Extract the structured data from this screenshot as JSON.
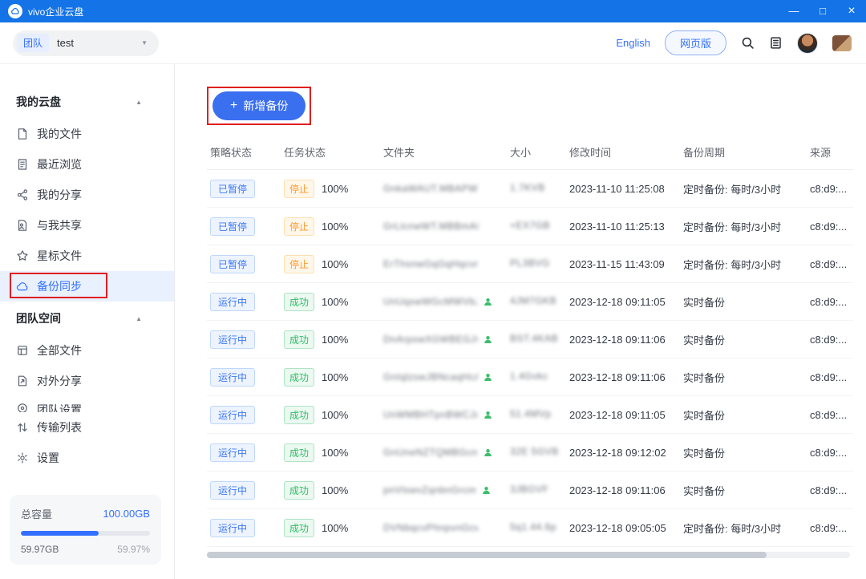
{
  "window": {
    "title": "vivo企业云盘",
    "controls": {
      "minimize": "—",
      "maximize": "□",
      "close": "×"
    }
  },
  "toolbar": {
    "team_badge": "团队",
    "team_name": "test",
    "caret": "▼",
    "english_link": "English",
    "web_version": "网页版"
  },
  "sidebar": {
    "collapse_glyph": "▲",
    "groups": [
      {
        "id": "my-cloud",
        "label": "我的云盘",
        "items": [
          {
            "id": "my-files",
            "icon": "file",
            "label": "我的文件"
          },
          {
            "id": "recent",
            "icon": "recent",
            "label": "最近浏览"
          },
          {
            "id": "my-share",
            "icon": "share",
            "label": "我的分享"
          },
          {
            "id": "shared-with-me",
            "icon": "shared",
            "label": "与我共享"
          },
          {
            "id": "starred",
            "icon": "star",
            "label": "星标文件"
          },
          {
            "id": "backup-sync",
            "icon": "cloud",
            "label": "备份同步",
            "selected": true,
            "annotated": true
          }
        ]
      },
      {
        "id": "team-space",
        "label": "团队空间",
        "items": [
          {
            "id": "all-files",
            "icon": "files",
            "label": "全部文件"
          },
          {
            "id": "external-share",
            "icon": "external",
            "label": "对外分享"
          },
          {
            "id": "team-settings",
            "icon": "circle",
            "label": "团队设置",
            "clipped": true
          }
        ]
      }
    ],
    "tools": [
      {
        "id": "transfer-list",
        "icon": "transfer",
        "label": "传输列表"
      },
      {
        "id": "settings",
        "icon": "gear",
        "label": "设置"
      }
    ],
    "storage": {
      "total_label": "总容量",
      "total_value": "100.00GB",
      "used_value": "59.97GB",
      "used_percent": "59.97%",
      "bar_style": "width:59.97%"
    }
  },
  "main": {
    "add_button": {
      "icon": "+",
      "label": "新增备份"
    },
    "table": {
      "columns": [
        "策略状态",
        "任务状态",
        "文件夹",
        "大小",
        "修改时间",
        "备份周期",
        "来源"
      ],
      "rows": [
        {
          "policy": "已暂停",
          "task": "停止",
          "task_style": "orange",
          "progress": "100%",
          "folder": "GnkaWAUT.MBAPWHL",
          "member": false,
          "size": "1.7KVB",
          "modified": "2023-11-10 11:25:08",
          "cycle": "定时备份: 每时/3小时",
          "source": "c8:d9:..."
        },
        {
          "policy": "已暂停",
          "task": "停止",
          "task_style": "orange",
          "progress": "100%",
          "folder": "GrLlcnwWT.MBBmABvM",
          "member": false,
          "size": "+EX7GB",
          "modified": "2023-11-10 11:25:13",
          "cycle": "定时备份: 每时/3小时",
          "source": "c8:d9:..."
        },
        {
          "policy": "已暂停",
          "task": "停止",
          "task_style": "orange",
          "progress": "100%",
          "folder": "ErThsnwGqGqHqcvna",
          "member": false,
          "size": "PL3BVG",
          "modified": "2023-11-15 11:43:09",
          "cycle": "定时备份: 每时/3小时",
          "source": "c8:d9:..."
        },
        {
          "policy": "运行中",
          "task": "成功",
          "task_style": "green",
          "progress": "100%",
          "folder": "UnUqswWGcMWVbJm",
          "member": true,
          "size": "4JM7GKB",
          "modified": "2023-12-18 09:11:05",
          "cycle": "实时备份",
          "source": "c8:d9:..."
        },
        {
          "policy": "运行中",
          "task": "成功",
          "task_style": "green",
          "progress": "100%",
          "folder": "DnArpswXGWBEGJvc",
          "member": true,
          "size": "BST.4KAB",
          "modified": "2023-12-18 09:11:06",
          "cycle": "实时备份",
          "source": "c8:d9:..."
        },
        {
          "policy": "运行中",
          "task": "成功",
          "task_style": "green",
          "progress": "100%",
          "folder": "GnIqlzswJBNcaqHcA",
          "member": true,
          "size": "1.4Gvkc",
          "modified": "2023-12-18 09:11:06",
          "cycle": "实时备份",
          "source": "c8:d9:..."
        },
        {
          "policy": "运行中",
          "task": "成功",
          "task_style": "green",
          "progress": "100%",
          "folder": "UnWMBHTpnBWCJcv",
          "member": true,
          "size": "51.4MVp",
          "modified": "2023-12-18 09:11:05",
          "cycle": "实时备份",
          "source": "c8:d9:..."
        },
        {
          "policy": "运行中",
          "task": "成功",
          "task_style": "green",
          "progress": "100%",
          "folder": "GnUneNZTQMBGcnw",
          "member": true,
          "size": "32E 5GVB",
          "modified": "2023-12-18 09:12:02",
          "cycle": "实时备份",
          "source": "c8:d9:..."
        },
        {
          "policy": "运行中",
          "task": "成功",
          "task_style": "green",
          "progress": "100%",
          "folder": "pnVlswvZqnbnGrcm",
          "member": true,
          "size": "3JBGVF",
          "modified": "2023-12-18 09:11:06",
          "cycle": "实时备份",
          "source": "c8:d9:..."
        },
        {
          "policy": "运行中",
          "task": "成功",
          "task_style": "green",
          "progress": "100%",
          "folder": "DVNbqcvPhnpvnGcw",
          "member": false,
          "size": "5q1.44.6p",
          "modified": "2023-12-18 09:05:05",
          "cycle": "定时备份: 每时/3小时",
          "source": "c8:d9:..."
        }
      ]
    }
  },
  "colors": {
    "titlebar_blue": "#1473E6",
    "accent_blue": "#3370FF",
    "annotation_red": "#E01E1E",
    "success_green": "#33BB66",
    "warning_orange": "#FF9A2E"
  }
}
